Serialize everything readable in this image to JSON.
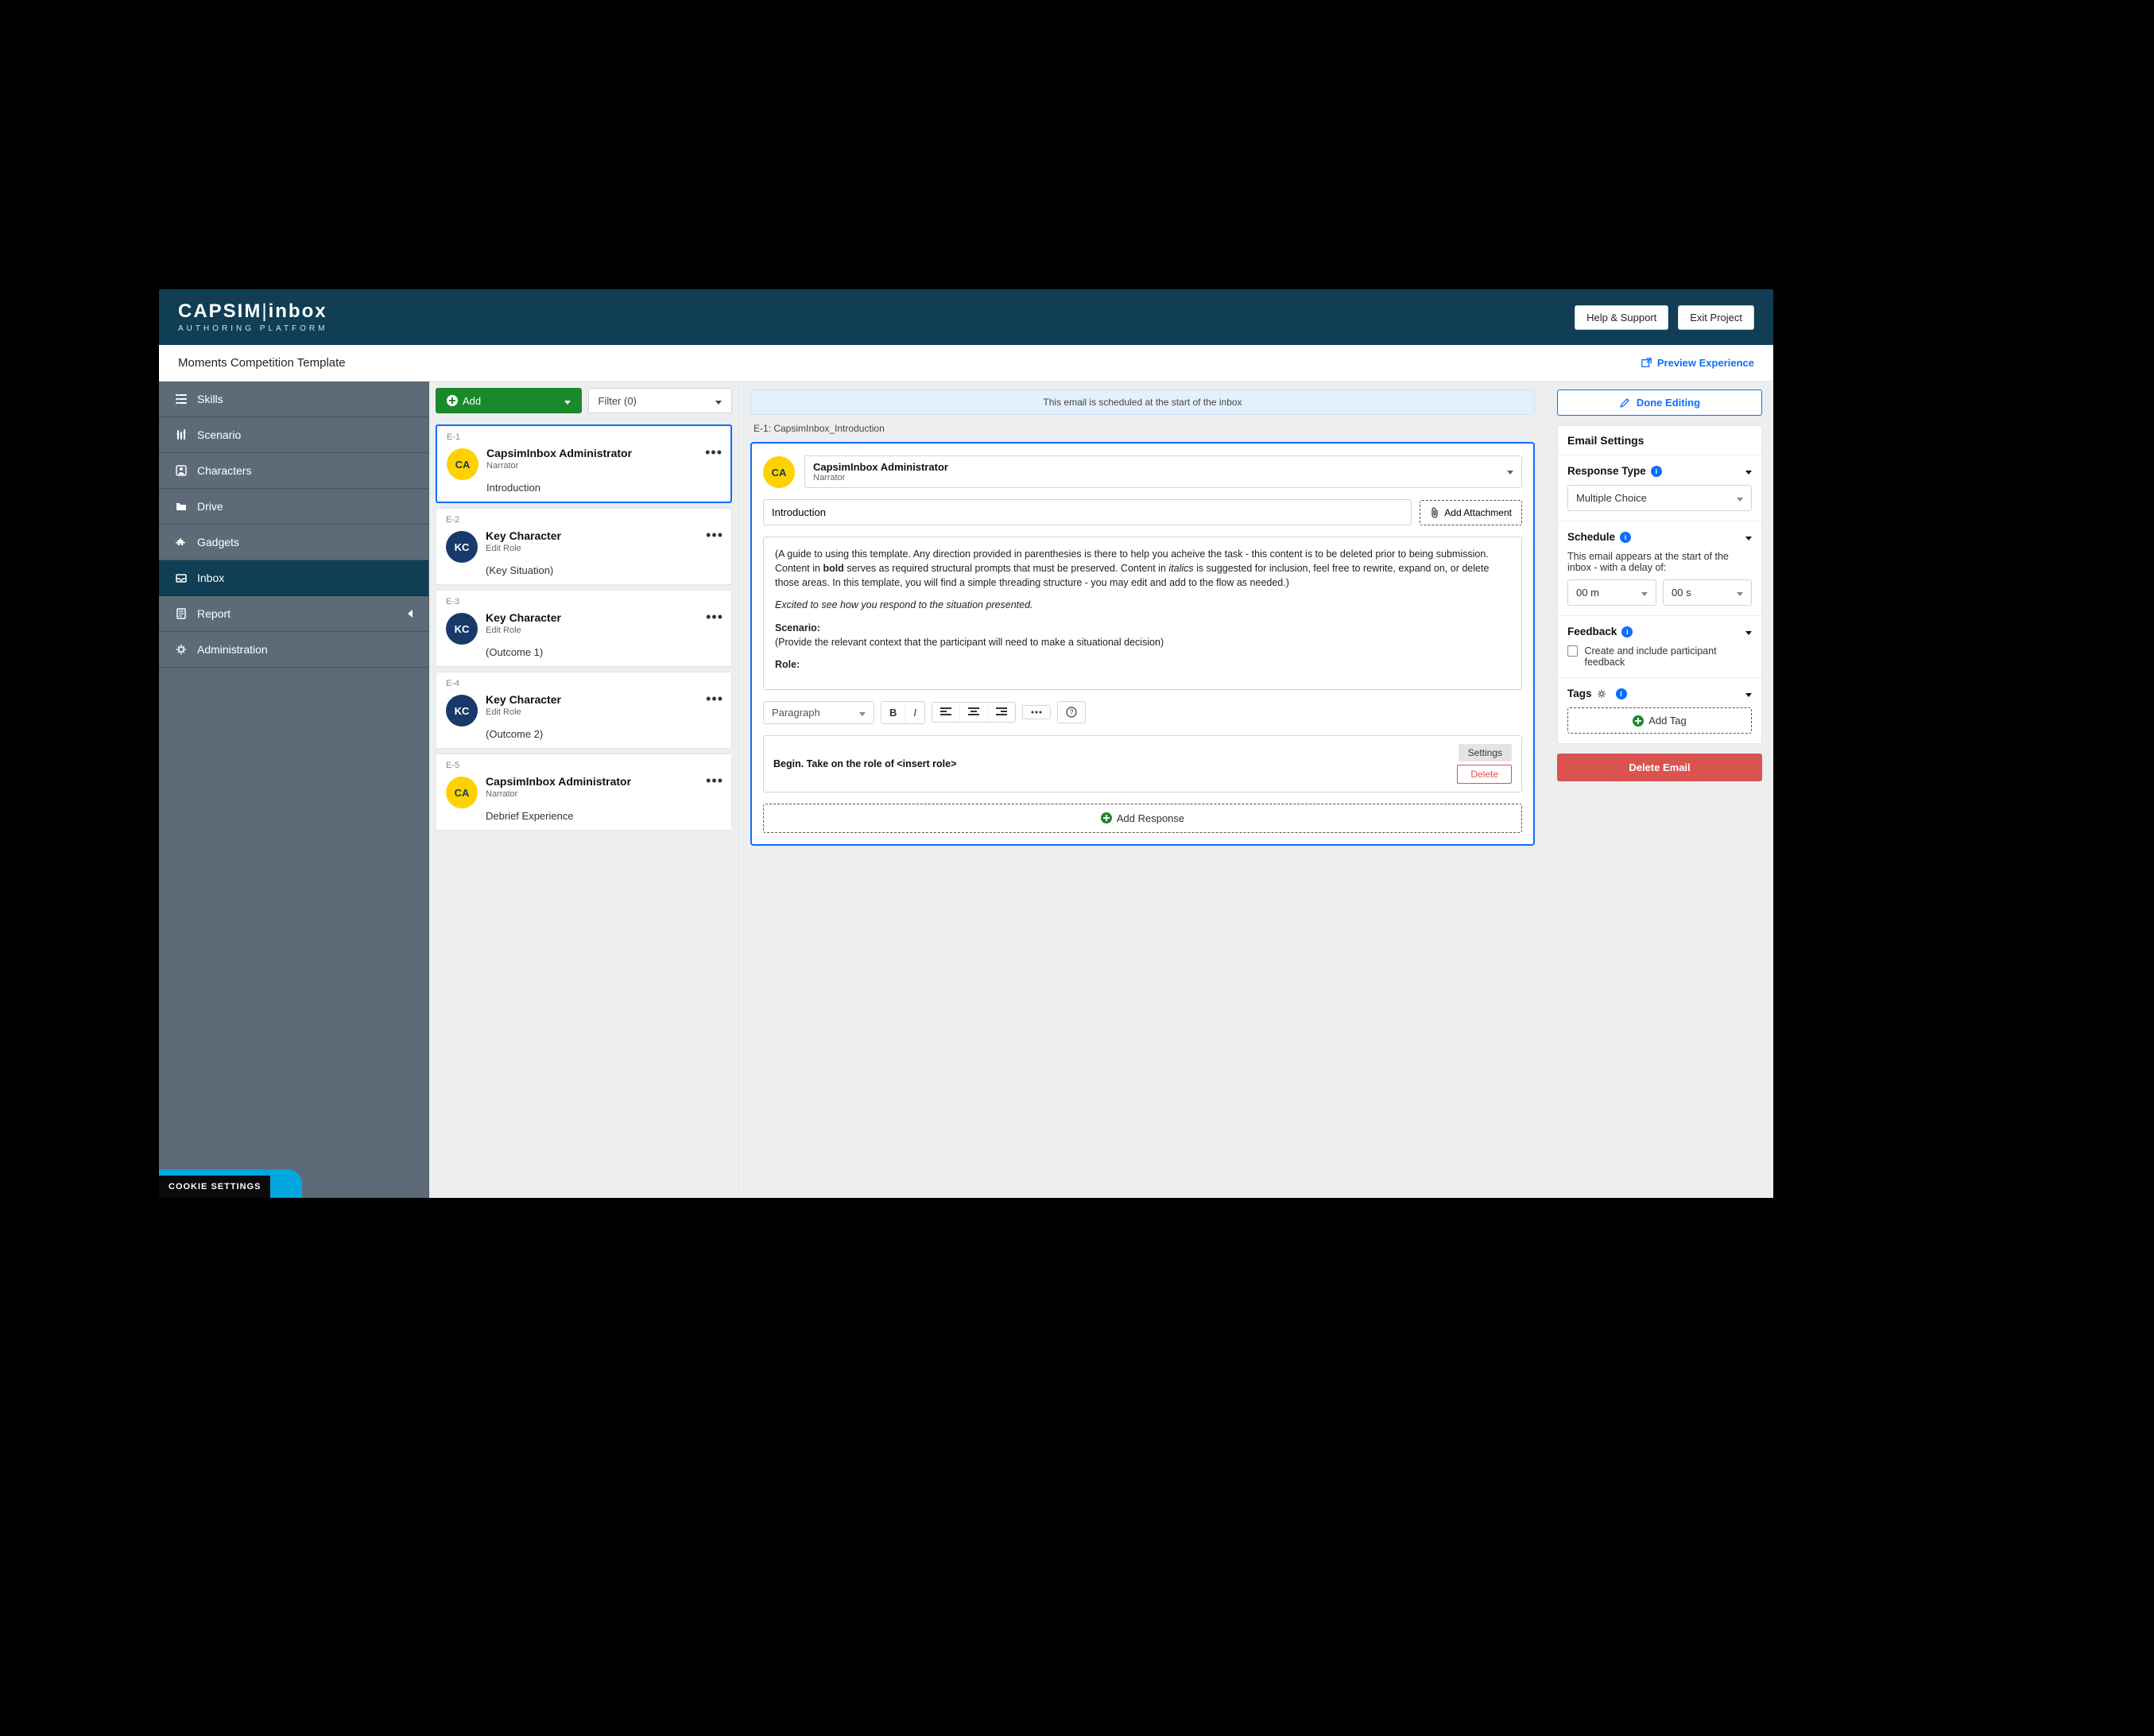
{
  "header": {
    "logo_primary": "CAPSIM",
    "logo_secondary": "inbox",
    "subtitle": "AUTHORING PLATFORM",
    "help_btn": "Help & Support",
    "exit_btn": "Exit Project"
  },
  "subheader": {
    "title": "Moments Competition Template",
    "preview": "Preview Experience"
  },
  "sidebar": {
    "items": [
      {
        "label": "Skills"
      },
      {
        "label": "Scenario"
      },
      {
        "label": "Characters"
      },
      {
        "label": "Drive"
      },
      {
        "label": "Gadgets"
      },
      {
        "label": "Inbox"
      },
      {
        "label": "Report"
      },
      {
        "label": "Administration"
      }
    ],
    "cookie": "COOKIE SETTINGS"
  },
  "list": {
    "add": "Add",
    "filter": "Filter (0)",
    "items": [
      {
        "id": "E-1",
        "from": "CapsimInbox Administrator",
        "role": "Narrator",
        "subject": "Introduction",
        "initials": "CA",
        "accent": "yellow",
        "selected": true
      },
      {
        "id": "E-2",
        "from": "Key Character",
        "role": "Edit Role",
        "subject": "(Key Situation)",
        "initials": "KC",
        "accent": "navy"
      },
      {
        "id": "E-3",
        "from": "Key Character",
        "role": "Edit Role",
        "subject": "(Outcome 1)",
        "initials": "KC",
        "accent": "navy"
      },
      {
        "id": "E-4",
        "from": "Key Character",
        "role": "Edit Role",
        "subject": "(Outcome 2)",
        "initials": "KC",
        "accent": "navy"
      },
      {
        "id": "E-5",
        "from": "CapsimInbox Administrator",
        "role": "Narrator",
        "subject": "Debrief Experience",
        "initials": "CA",
        "accent": "yellow"
      }
    ]
  },
  "center": {
    "schedule_note": "This email is scheduled at the start of the inbox",
    "eid": "E-1: CapsimInbox_Introduction",
    "from_name": "CapsimInbox Administrator",
    "from_role": "Narrator",
    "from_initials": "CA",
    "subject_value": "Introduction",
    "attach": "Add Attachment",
    "body": {
      "p1_a": "(A guide to using this template. Any direction provided in parenthesies is there to help you acheive the task - this content is to be deleted prior to being submission. Content in ",
      "p1_b": "bold",
      "p1_c": " serves as required structural prompts that must be preserved. Content in ",
      "p1_d": "italics",
      "p1_e": " is suggested for inclusion, feel free to rewrite, expand on, or delete those areas. In this template, you will find a simple threading structure - you may edit and add to the flow as needed.)",
      "p2": "Excited to see how you respond to the situation presented.",
      "scenario_h": "Scenario:",
      "scenario_p": "(Provide the relevant context that the participant will need to make a situational decision)",
      "role_h": "Role:"
    },
    "toolbar": {
      "para": "Paragraph"
    },
    "response": {
      "text": "Begin. Take on the role of <insert role>",
      "settings": "Settings",
      "delete": "Delete"
    },
    "add_response": "Add Response"
  },
  "right": {
    "done": "Done Editing",
    "settings_title": "Email Settings",
    "resp_type_label": "Response Type",
    "resp_type_value": "Multiple Choice",
    "schedule_label": "Schedule",
    "schedule_desc": "This email appears at the start of the inbox - with a delay of:",
    "delay_m": "00 m",
    "delay_s": "00 s",
    "feedback_label": "Feedback",
    "feedback_cb": "Create and include participant feedback",
    "tags_label": "Tags",
    "add_tag": "Add Tag",
    "delete_email": "Delete Email"
  }
}
